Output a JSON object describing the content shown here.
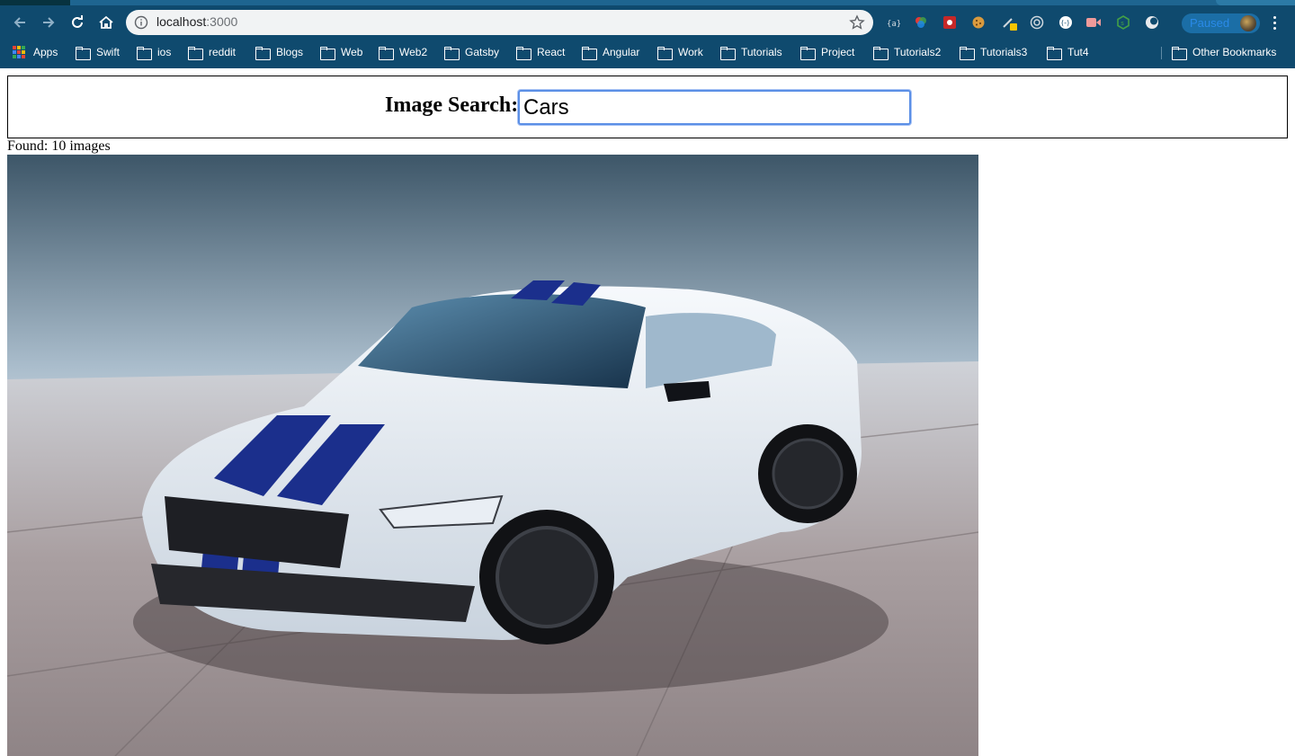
{
  "browser": {
    "url_host": "localhost",
    "url_port": ":3000",
    "profile_status": "Paused"
  },
  "bookmarks": {
    "apps": "Apps",
    "folders": [
      "Swift",
      "ios",
      "reddit",
      "Blogs",
      "Web",
      "Web2",
      "Gatsby",
      "React",
      "Angular",
      "Work",
      "Tutorials",
      "Project",
      "Tutorials2",
      "Tutorials3",
      "Tut4"
    ],
    "other": "Other Bookmarks"
  },
  "search": {
    "label": "Image Search:",
    "value": "Cars"
  },
  "results": {
    "found_text": "Found: 10 images",
    "first_image_alt": "white sports car with blue racing stripes"
  },
  "colors": {
    "chrome_bar": "#0f4a6e",
    "focus_ring": "#5b8fe6"
  }
}
